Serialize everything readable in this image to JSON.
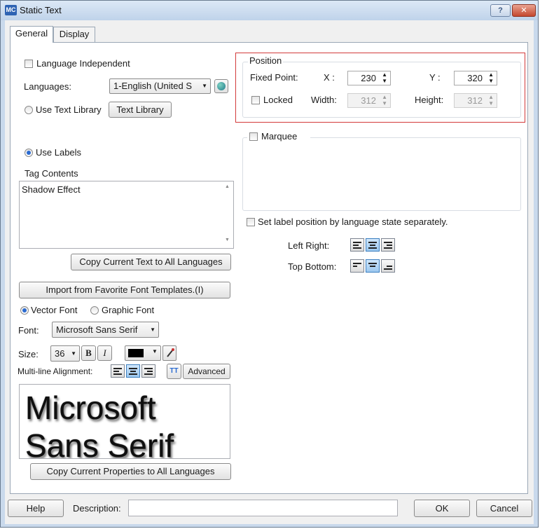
{
  "window": {
    "title": "Static Text",
    "icon_label": "MC",
    "help_glyph": "?",
    "close_glyph": "✕"
  },
  "tabs": [
    {
      "label": "General",
      "active": true
    },
    {
      "label": "Display",
      "active": false
    }
  ],
  "left": {
    "language_independent": {
      "label": "Language Independent",
      "checked": false
    },
    "languages": {
      "label": "Languages:",
      "selected": "1-English (United S",
      "globe_icon": "globe-icon"
    },
    "use_text_library": {
      "label": "Use Text Library",
      "checked": false
    },
    "text_library_button": "Text Library",
    "use_labels": {
      "label": "Use Labels",
      "checked": true
    },
    "tag_contents": {
      "label": "Tag Contents",
      "value": "Shadow Effect"
    },
    "copy_text_button": "Copy Current Text to All Languages",
    "import_font_button": "Import from Favorite Font Templates.(I)",
    "vector_font": {
      "label": "Vector Font",
      "checked": true
    },
    "graphic_font": {
      "label": "Graphic Font",
      "checked": false
    },
    "font": {
      "label": "Font:",
      "selected": "Microsoft Sans Serif"
    },
    "size": {
      "label": "Size:",
      "selected": "36"
    },
    "bold_label": "B",
    "italic_label": "I",
    "font_color": "#000000",
    "multiline": {
      "label": "Multi-line Alignment:",
      "selected": "center"
    },
    "advanced_icon_label": "TT",
    "advanced_button": "Advanced",
    "preview_text": "Microsoft Sans Serif",
    "copy_properties_button": "Copy Current Properties to All Languages"
  },
  "position": {
    "title": "Position",
    "fixed_point_label": "Fixed Point:",
    "x_label": "X :",
    "x_value": "230",
    "y_label": "Y :",
    "y_value": "320",
    "locked": {
      "label": "Locked",
      "checked": false
    },
    "width_label": "Width:",
    "width_value": "312",
    "height_label": "Height:",
    "height_value": "312"
  },
  "marquee": {
    "label": "Marquee",
    "checked": false
  },
  "label_position": {
    "checkbox_label": "Set label position by language  state separately.",
    "checked": false,
    "left_right_label": "Left Right:",
    "left_right_selected": "center",
    "top_bottom_label": "Top Bottom:",
    "top_bottom_selected": "center"
  },
  "footer": {
    "help_button": "Help",
    "description_label": "Description:",
    "description_value": "",
    "ok_button": "OK",
    "cancel_button": "Cancel"
  },
  "colors": {
    "highlight_border": "#d33a3a",
    "selected_align": "#9cc8ef"
  }
}
